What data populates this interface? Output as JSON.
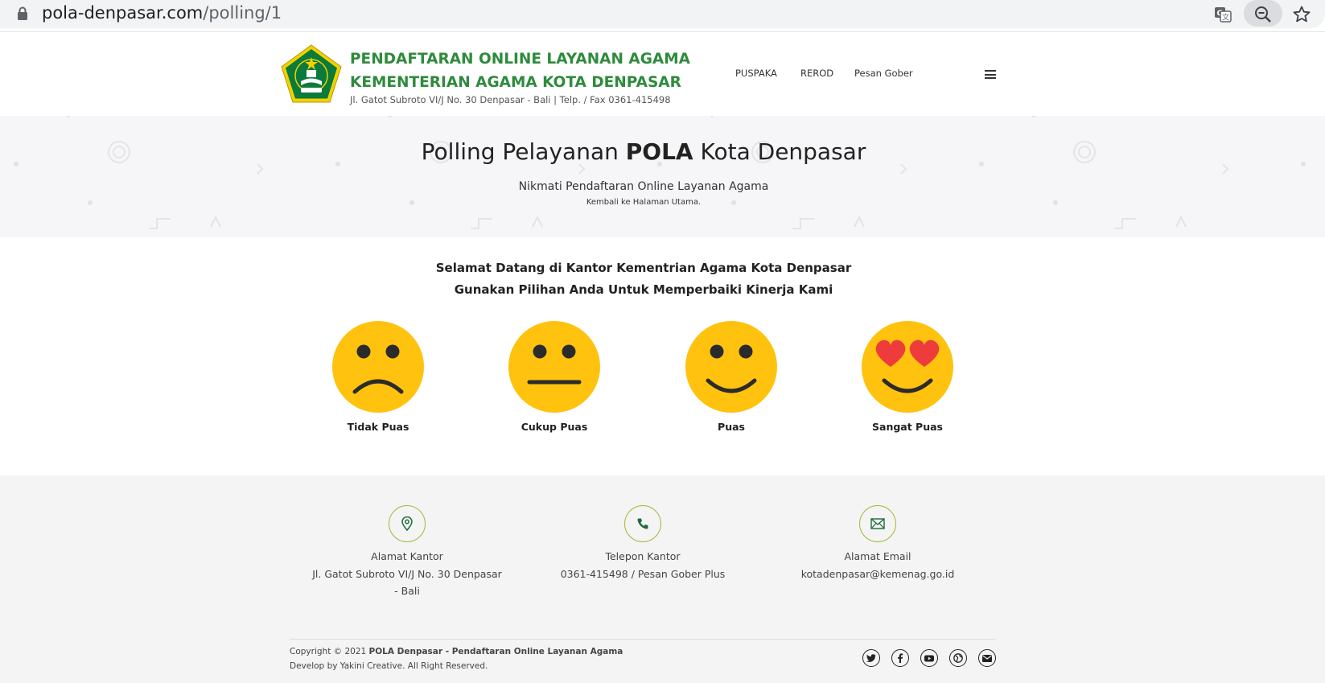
{
  "browser": {
    "url_host": "pola-denpasar.com",
    "url_path": "/polling/1"
  },
  "header": {
    "title_line1": "PENDAFTARAN ONLINE LAYANAN AGAMA",
    "title_line2": "KEMENTERIAN AGAMA KOTA DENPASAR",
    "address": "Jl. Gatot Subroto VI/J No. 30 Denpasar - Bali | Telp. / Fax 0361-415498",
    "nav": [
      "PUSPAKA",
      "REROD",
      "Pesan Gober"
    ]
  },
  "hero": {
    "title_pre": "Polling Pelayanan ",
    "title_bold": "POLA",
    "title_post": " Kota Denpasar",
    "subtitle": "Nikmati Pendaftaran Online Layanan Agama",
    "back_link": "Kembali ke Halaman Utama."
  },
  "main": {
    "welcome_line1": "Selamat Datang di Kantor Kementrian Agama Kota Denpasar",
    "welcome_line2": "Gunakan Pilihan Anda Untuk Memperbaiki Kinerja Kami",
    "options": [
      {
        "label": "Tidak Puas",
        "icon": "sad-face-icon"
      },
      {
        "label": "Cukup Puas",
        "icon": "neutral-face-icon"
      },
      {
        "label": "Puas",
        "icon": "smile-face-icon"
      },
      {
        "label": "Sangat Puas",
        "icon": "heart-eyes-face-icon"
      }
    ]
  },
  "footer": {
    "contacts": [
      {
        "title": "Alamat Kantor",
        "text": "Jl. Gatot Subroto VI/J No. 30 Denpasar - Bali",
        "icon": "location-pin-icon"
      },
      {
        "title": "Telepon Kantor",
        "text": "0361-415498 / Pesan Gober Plus",
        "icon": "phone-icon"
      },
      {
        "title": "Alamat Email",
        "text": "kotadenpasar@kemenag.go.id",
        "icon": "mail-icon"
      }
    ],
    "copyright_pre": "Copyright © 2021 ",
    "copyright_bold": "POLA Denpasar - Pendaftaran Online Layanan Agama",
    "develop_pre": "Develop by ",
    "develop_name": "Yakini Creative",
    "develop_post": ". All Right Reserved.",
    "social_icons": [
      "twitter-icon",
      "facebook-icon",
      "youtube-icon",
      "website-icon",
      "email-icon"
    ]
  },
  "colors": {
    "brand_green": "#2e8b3c",
    "face_yellow": "#ffc20e",
    "heart_red": "#ee3b3b",
    "contact_ring": "#a8b83a"
  }
}
